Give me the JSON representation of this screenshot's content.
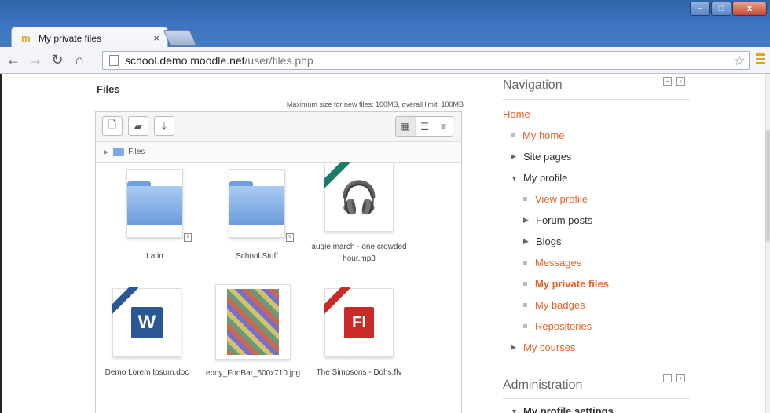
{
  "browser": {
    "tab_title": "My private files",
    "tab_close": "×",
    "url_host": "school.demo.moodle.net",
    "url_path": "/user/files.php"
  },
  "main": {
    "heading": "Files",
    "max_size_text": "Maximum size for new files: 100MB, overall limit: 100MB",
    "path_label": "Files",
    "files": [
      {
        "name": "Latin",
        "type": "folder"
      },
      {
        "name": "School Stuff",
        "type": "folder"
      },
      {
        "name": "augie march - one crowded hour.mp3",
        "type": "audio"
      },
      {
        "name": "Demo Lorem Ipsum.doc",
        "type": "word"
      },
      {
        "name": "eboy_FooBar_500x710.jpg",
        "type": "image"
      },
      {
        "name": "The Simpsons - Dohs.flv",
        "type": "flash"
      }
    ]
  },
  "navigation": {
    "title": "Navigation",
    "home": "Home",
    "my_home": "My home",
    "site_pages": "Site pages",
    "my_profile": "My profile",
    "view_profile": "View profile",
    "forum_posts": "Forum posts",
    "blogs": "Blogs",
    "messages": "Messages",
    "my_private_files": "My private files",
    "my_badges": "My badges",
    "repositories": "Repositories",
    "my_courses": "My courses"
  },
  "administration": {
    "title": "Administration",
    "first_item": "My profile settings"
  },
  "colors": {
    "link": "#e8622a",
    "brand": "#e8a316"
  }
}
